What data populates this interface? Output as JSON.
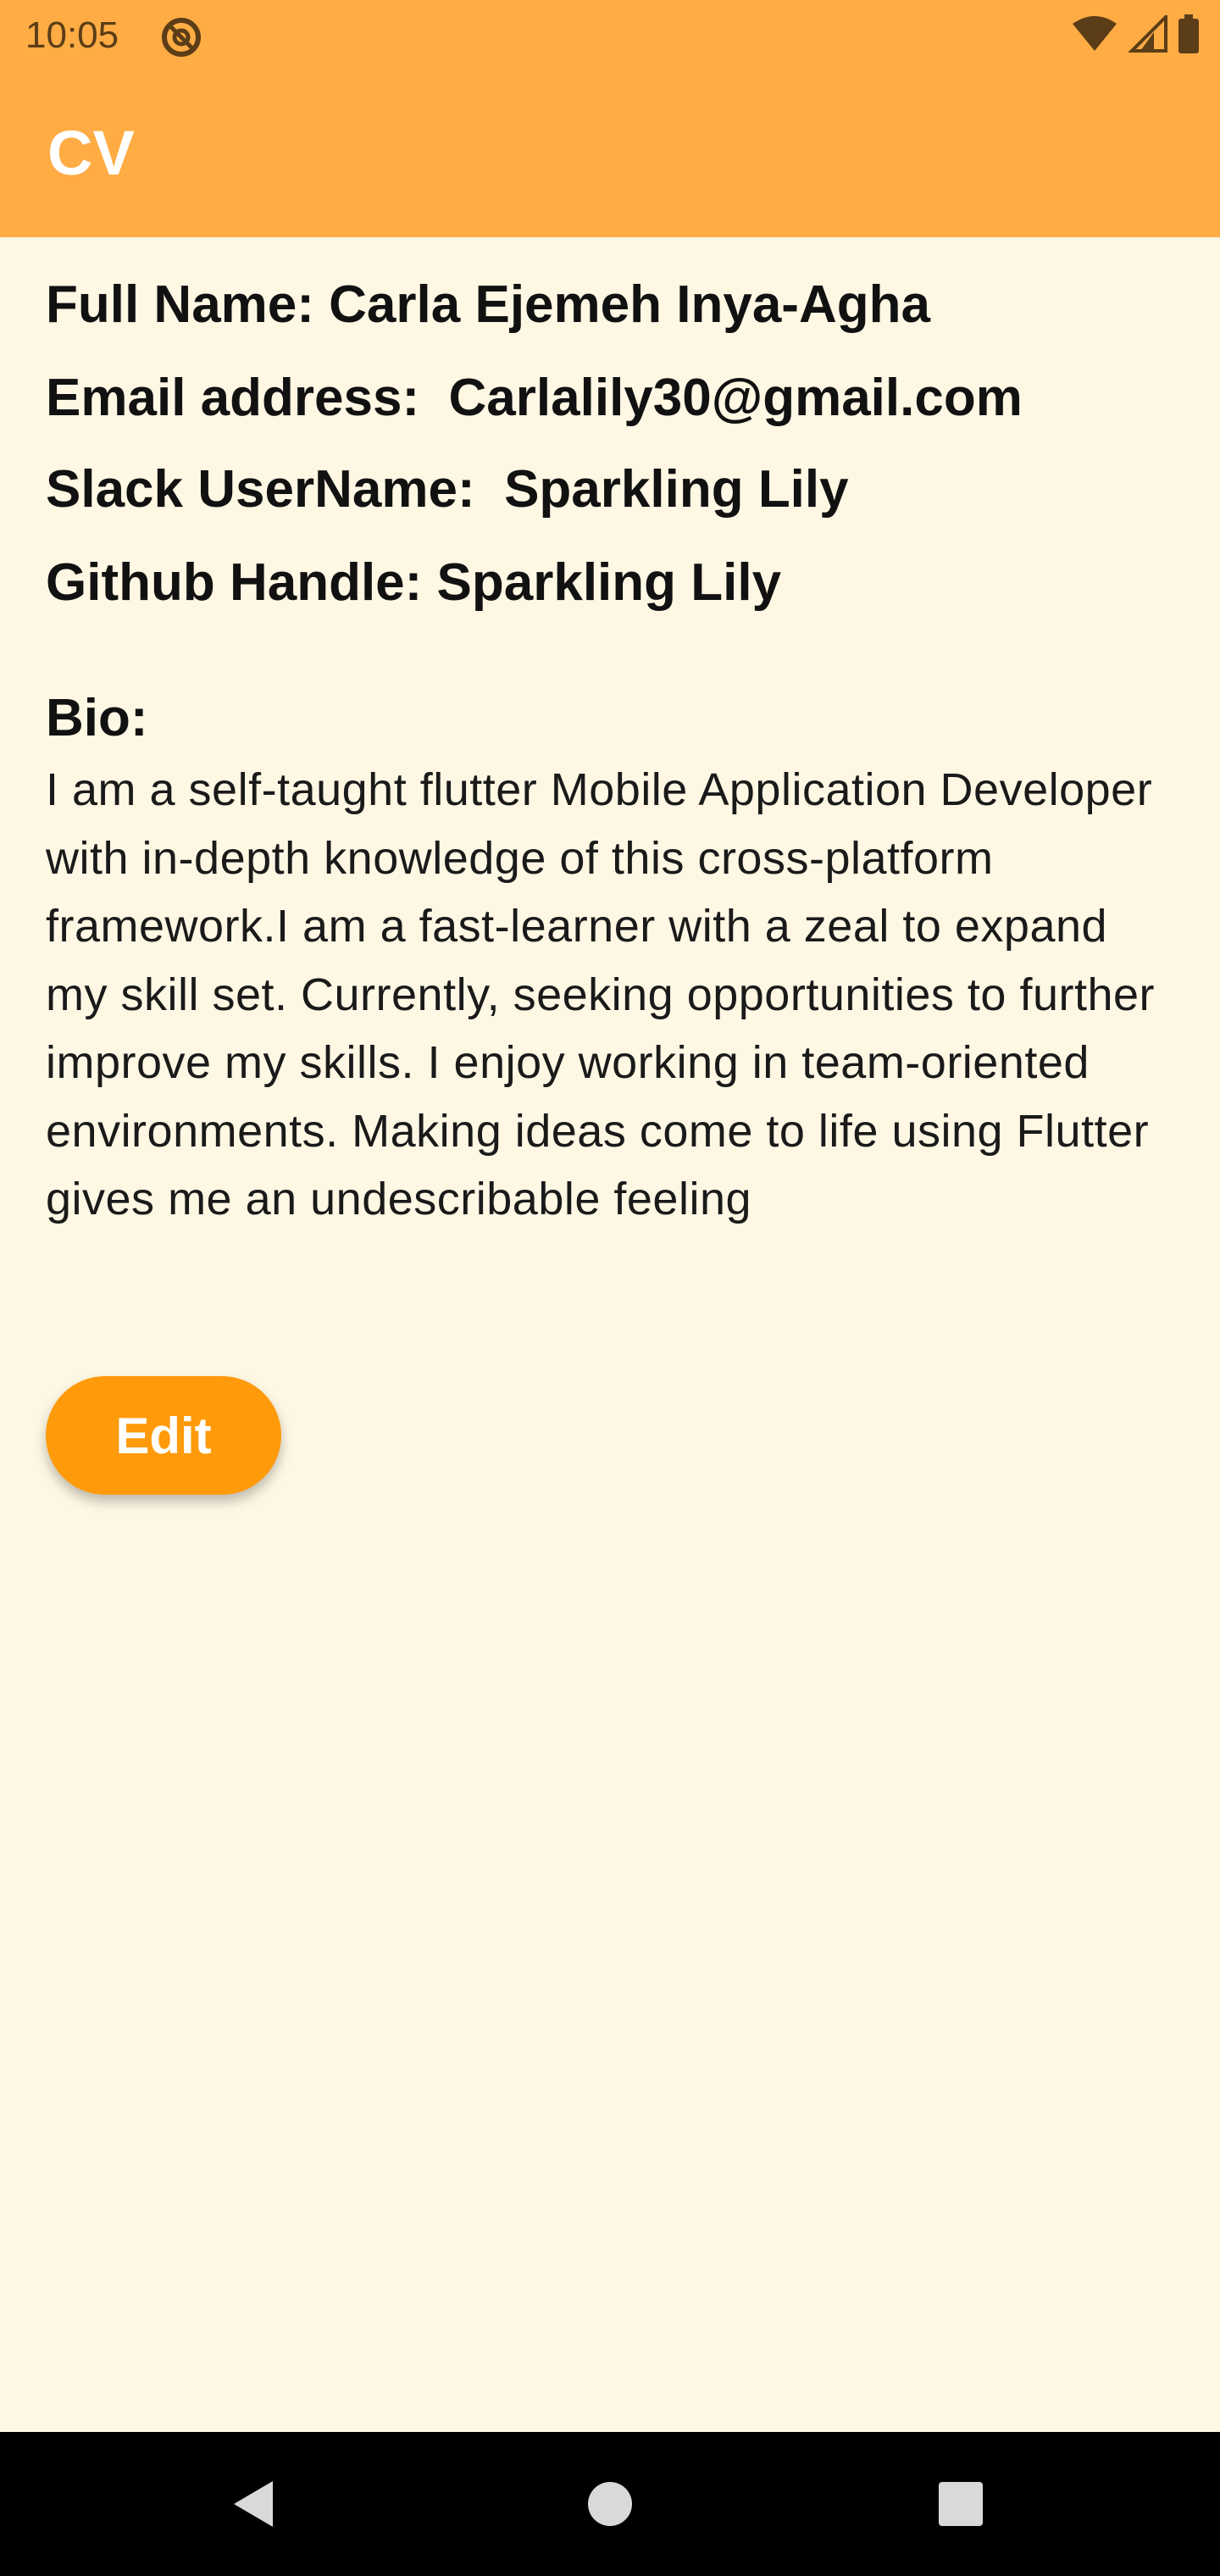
{
  "status_bar": {
    "time": "10:05",
    "icons": [
      "do-not-disturb-icon",
      "wifi-icon",
      "signal-icon",
      "battery-icon"
    ]
  },
  "app_bar": {
    "title": "CV",
    "color": "#FFAC45"
  },
  "profile": {
    "full_name": "Full Name: Carla Ejemeh Inya-Agha",
    "email": "Email address:  Carlalily30@gmail.com",
    "slack": "Slack UserName:  Sparkling Lily",
    "github": "Github Handle: Sparkling Lily"
  },
  "bio": {
    "label": "Bio:",
    "text": "I am a self-taught flutter Mobile Application Developer with in-depth knowledge of this cross-platform framework.I am a fast-learner with a zeal to expand my skill set. Currently, seeking opportunities to further improve my skills.  I enjoy working in team-oriented environments. Making ideas come to life using Flutter gives me an undescribable feeling"
  },
  "actions": {
    "edit_label": "Edit",
    "edit_color": "#FF9A0A"
  },
  "nav_bar": {
    "buttons": [
      "back-icon",
      "home-icon",
      "recents-icon"
    ]
  }
}
